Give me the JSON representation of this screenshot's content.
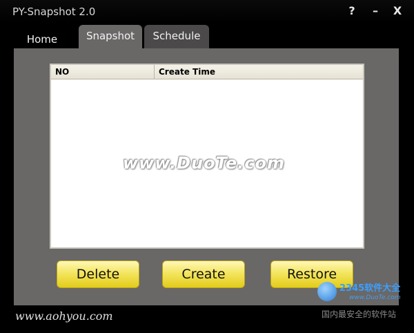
{
  "window": {
    "title": "PY-Snapshot 2.0",
    "help_label": "?",
    "minimize_label": "–",
    "close_label": "X"
  },
  "tabs": [
    {
      "label": "Home",
      "active": false
    },
    {
      "label": "Snapshot",
      "active": true
    },
    {
      "label": "Schedule",
      "active": false
    }
  ],
  "table": {
    "columns": [
      "NO",
      "Create Time"
    ],
    "rows": []
  },
  "watermark": "www.DuoTe.com",
  "buttons": {
    "delete": "Delete",
    "create": "Create",
    "restore": "Restore"
  },
  "footer": {
    "url": "www.aohyou.com"
  },
  "overlay_logo": {
    "brand": "2345软件大全",
    "brand_url": "www.DuoTe.com",
    "slogan": "国内最安全的软件站"
  },
  "colors": {
    "window_bg": "#000000",
    "panel_bg": "#6a6767",
    "button_yellow": "#f4e560",
    "list_bg": "#ffffff"
  },
  "icons": [
    "help-icon",
    "minimize-icon",
    "close-icon",
    "duote-logo-icon"
  ]
}
